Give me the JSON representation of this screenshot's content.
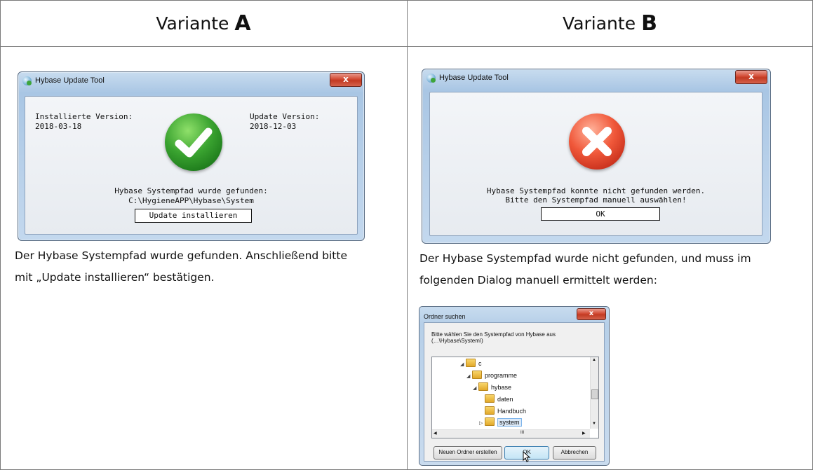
{
  "headers": {
    "a_word": "Variante",
    "a_letter": "A",
    "b_word": "Variante",
    "b_letter": "B"
  },
  "dialog_a": {
    "title": "Hybase Update Tool",
    "close": "x",
    "installed_label": "Installierte Version:",
    "installed_value": "2018-03-18",
    "update_label": "Update Version:",
    "update_value": "2018-12-03",
    "status_icon": "success-check-icon",
    "message": "Hybase Systempfad wurde gefunden:",
    "path": "C:\\HygieneAPP\\Hybase\\System",
    "button": "Update installieren"
  },
  "caption_a": {
    "line1": "Der Hybase Systempfad wurde gefunden. Anschließend bitte",
    "line2": "mit „Update installieren“ bestätigen."
  },
  "dialog_b": {
    "title": "Hybase Update Tool",
    "close": "x",
    "status_icon": "error-cross-icon",
    "message1": "Hybase Systempfad konnte nicht gefunden werden.",
    "message2": "Bitte den Systempfad manuell auswählen!",
    "button": "OK"
  },
  "caption_b": {
    "line1": "Der Hybase Systempfad wurde nicht gefunden, und muss im",
    "line2": "folgenden Dialog manuell ermittelt werden:"
  },
  "folder_dialog": {
    "title": "Ordner suchen",
    "close": "x",
    "instruction1": "Bitte wählen Sie den Systempfad von Hybase aus",
    "instruction2": "(…\\Hybase\\System\\)",
    "tree": [
      "c",
      "programme",
      "hybase",
      "daten",
      "Handbuch",
      "system"
    ],
    "scroll_mark": "III",
    "new_folder_button": "Neuen Ordner erstellen",
    "ok_button": "OK",
    "cancel_button": "Abbrechen"
  },
  "colors": {
    "border": "#7a7a7a",
    "title_glass": "#b9d1ea",
    "close_red": "#c23a22",
    "check_green": "#3aa330",
    "cross_red": "#e04a2c"
  }
}
